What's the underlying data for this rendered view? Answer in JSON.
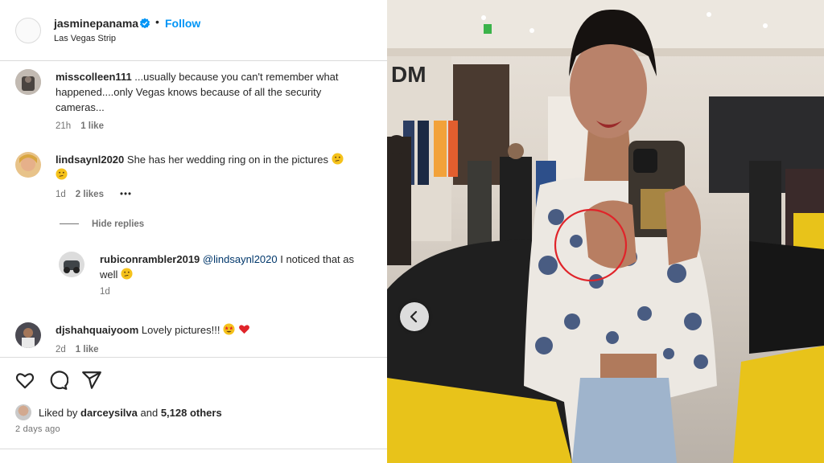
{
  "post": {
    "username": "jasminepanama",
    "follow_label": "Follow",
    "separator": "•",
    "location": "Las Vegas Strip"
  },
  "comments": [
    {
      "username": "misscolleen111",
      "text": " ...usually because you can't remember what happened....only Vegas knows because of all the security cameras...",
      "time": "21h",
      "likes": "1 like"
    },
    {
      "username": "lindsaynl2020",
      "text": " She has her wedding ring on in the pictures",
      "emoji": "thinking-face",
      "time": "1d",
      "likes": "2 likes",
      "more": "•••"
    },
    {
      "username": "djshahquaiyoom",
      "text": " Lovely pictures!!!",
      "emoji": [
        "star-struck-face",
        "red-heart"
      ],
      "time": "2d",
      "likes": "1 like"
    }
  ],
  "reply_toggle": "Hide replies",
  "reply": {
    "username": "rubiconrambler2019",
    "mention": "@lindsaynl2020",
    "text": " I noticed that as well",
    "emoji": "thinking-face",
    "time": "1d"
  },
  "actions": {
    "liked_by_prefix": "Liked by ",
    "liked_by_user": "darceysilva",
    "liked_by_and": " and ",
    "others": "5,128 others",
    "posted": "2 days ago"
  },
  "colors": {
    "link_blue": "#0095f6",
    "meta_gray": "#737373",
    "divider": "#dbdbdb",
    "highlight_circle": "#e0242a",
    "car_yellow": "#e8c31a"
  }
}
